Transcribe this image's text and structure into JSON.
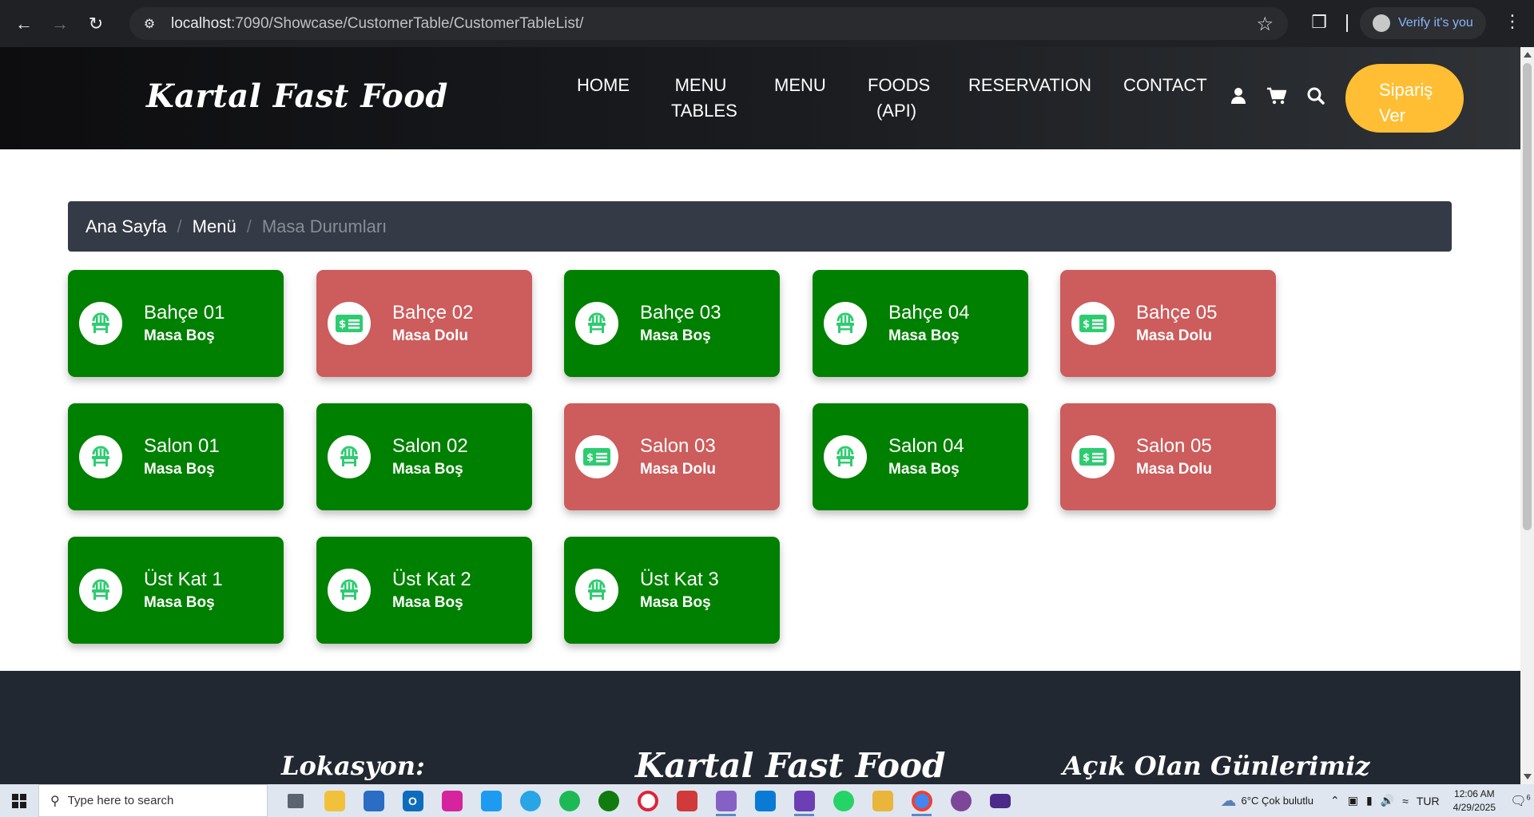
{
  "browser": {
    "url_host": "localhost",
    "url_path": ":7090/Showcase/CustomerTable/CustomerTableList/",
    "profile_label": "Verify it's you"
  },
  "header": {
    "brand": "Kartal Fast Food",
    "nav": {
      "home": "HOME",
      "menu_tables": "MENU TABLES",
      "menu": "MENU",
      "foods_api": "FOODS (API)",
      "reservation": "RESERVATION",
      "contact": "CONTACT"
    },
    "order_button": "Sipariş Ver"
  },
  "breadcrumb": {
    "home": "Ana Sayfa",
    "menu": "Menü",
    "current": "Masa Durumları"
  },
  "status_colors": {
    "free": "#008000",
    "full": "#cd5c5c"
  },
  "tables": [
    {
      "name": "Bahçe 01",
      "status": "Masa Boş",
      "state": "free"
    },
    {
      "name": "Bahçe 02",
      "status": "Masa Dolu",
      "state": "full"
    },
    {
      "name": "Bahçe 03",
      "status": "Masa Boş",
      "state": "free"
    },
    {
      "name": "Bahçe 04",
      "status": "Masa Boş",
      "state": "free"
    },
    {
      "name": "Bahçe 05",
      "status": "Masa Dolu",
      "state": "full"
    },
    {
      "name": "Salon 01",
      "status": "Masa Boş",
      "state": "free"
    },
    {
      "name": "Salon 02",
      "status": "Masa Boş",
      "state": "free"
    },
    {
      "name": "Salon 03",
      "status": "Masa Dolu",
      "state": "full"
    },
    {
      "name": "Salon 04",
      "status": "Masa Boş",
      "state": "free"
    },
    {
      "name": "Salon 05",
      "status": "Masa Dolu",
      "state": "full"
    },
    {
      "name": "Üst Kat 1",
      "status": "Masa Boş",
      "state": "free"
    },
    {
      "name": "Üst Kat 2",
      "status": "Masa Boş",
      "state": "free"
    },
    {
      "name": "Üst Kat 3",
      "status": "Masa Boş",
      "state": "free"
    }
  ],
  "footer": {
    "location_title": "Lokasyon:",
    "brand": "Kartal Fast Food",
    "open_days_title": "Açık Olan Günlerimiz"
  },
  "taskbar": {
    "search_placeholder": "Type here to search",
    "weather": "6°C  Çok bulutlu",
    "language": "TUR",
    "time": "12:06 AM",
    "date": "4/29/2025",
    "notification_count": "6"
  }
}
